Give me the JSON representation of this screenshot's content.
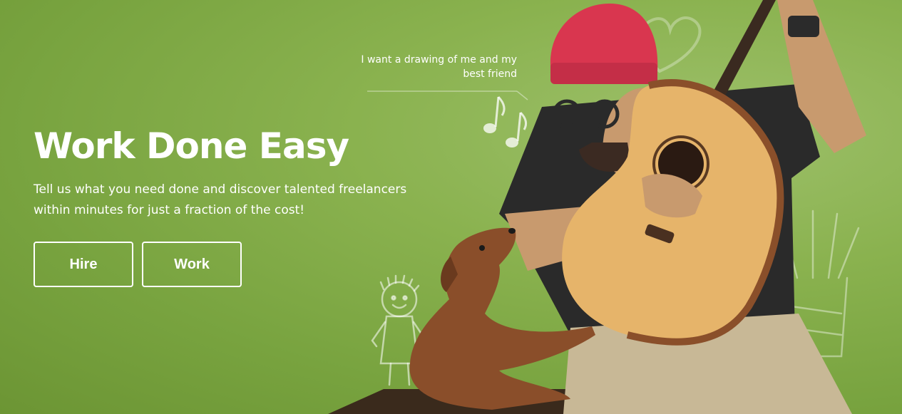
{
  "hero": {
    "title": "Work Done Easy",
    "subtitle": "Tell us what you need done and discover talented freelancers within minutes for just a fraction of the cost!",
    "speech_note": "I want a drawing of me and my best friend",
    "buttons": {
      "hire_label": "Hire",
      "work_label": "Work"
    }
  },
  "colors": {
    "background": "#8ab24f",
    "text": "#ffffff"
  },
  "icons": [
    "heart-doodle-icon",
    "music-notes-icon",
    "boy-doodle-icon",
    "pencil-cup-doodle-icon"
  ]
}
